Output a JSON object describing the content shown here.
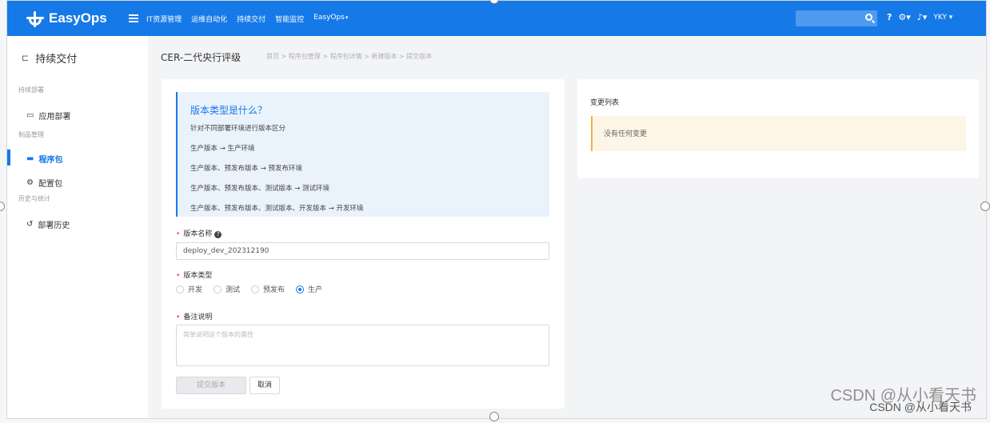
{
  "app": {
    "logo_text": "EasyOps"
  },
  "topnav": {
    "items": [
      "IT资源管理",
      "运维自动化",
      "持续交付",
      "智能监控",
      "EasyOps"
    ],
    "user": "YKY"
  },
  "sidebar": {
    "title": "持续交付",
    "groups": [
      "持续部署",
      "制品管理",
      "历史与统计"
    ],
    "items": [
      "应用部署",
      "程序包",
      "配置包",
      "部署历史"
    ]
  },
  "header": {
    "page_title": "CER-二代央行评级",
    "breadcrumb": "首页 > 程序包管理 > 程序包详情 > 新建版本 > 提交版本"
  },
  "info": {
    "title": "版本类型是什么？",
    "subtitle": "针对不同部署环境进行版本区分",
    "lines": [
      "生产版本 → 生产环境",
      "生产版本、预发布版本 → 预发布环境",
      "生产版本、预发布版本、测试版本 → 测试环境",
      "生产版本、预发布版本、测试版本、开发版本 → 开发环境"
    ]
  },
  "form": {
    "name_label": "版本名称",
    "name_value": "deploy_dev_202312190",
    "type_label": "版本类型",
    "types": [
      "开发",
      "测试",
      "预发布",
      "生产"
    ],
    "selected_type": "生产",
    "remark_label": "备注说明",
    "remark_placeholder": "简单说明这个版本的属性",
    "submit": "提交版本",
    "cancel": "取消"
  },
  "changes": {
    "title": "变更列表",
    "empty": "没有任何变更"
  },
  "watermark": {
    "main": "CSDN @从小看天书",
    "small": "CSDN @从小看天书"
  },
  "colors": {
    "primary": "#1679e8",
    "warning": "#f0b34a",
    "required": "#e84a4a"
  }
}
